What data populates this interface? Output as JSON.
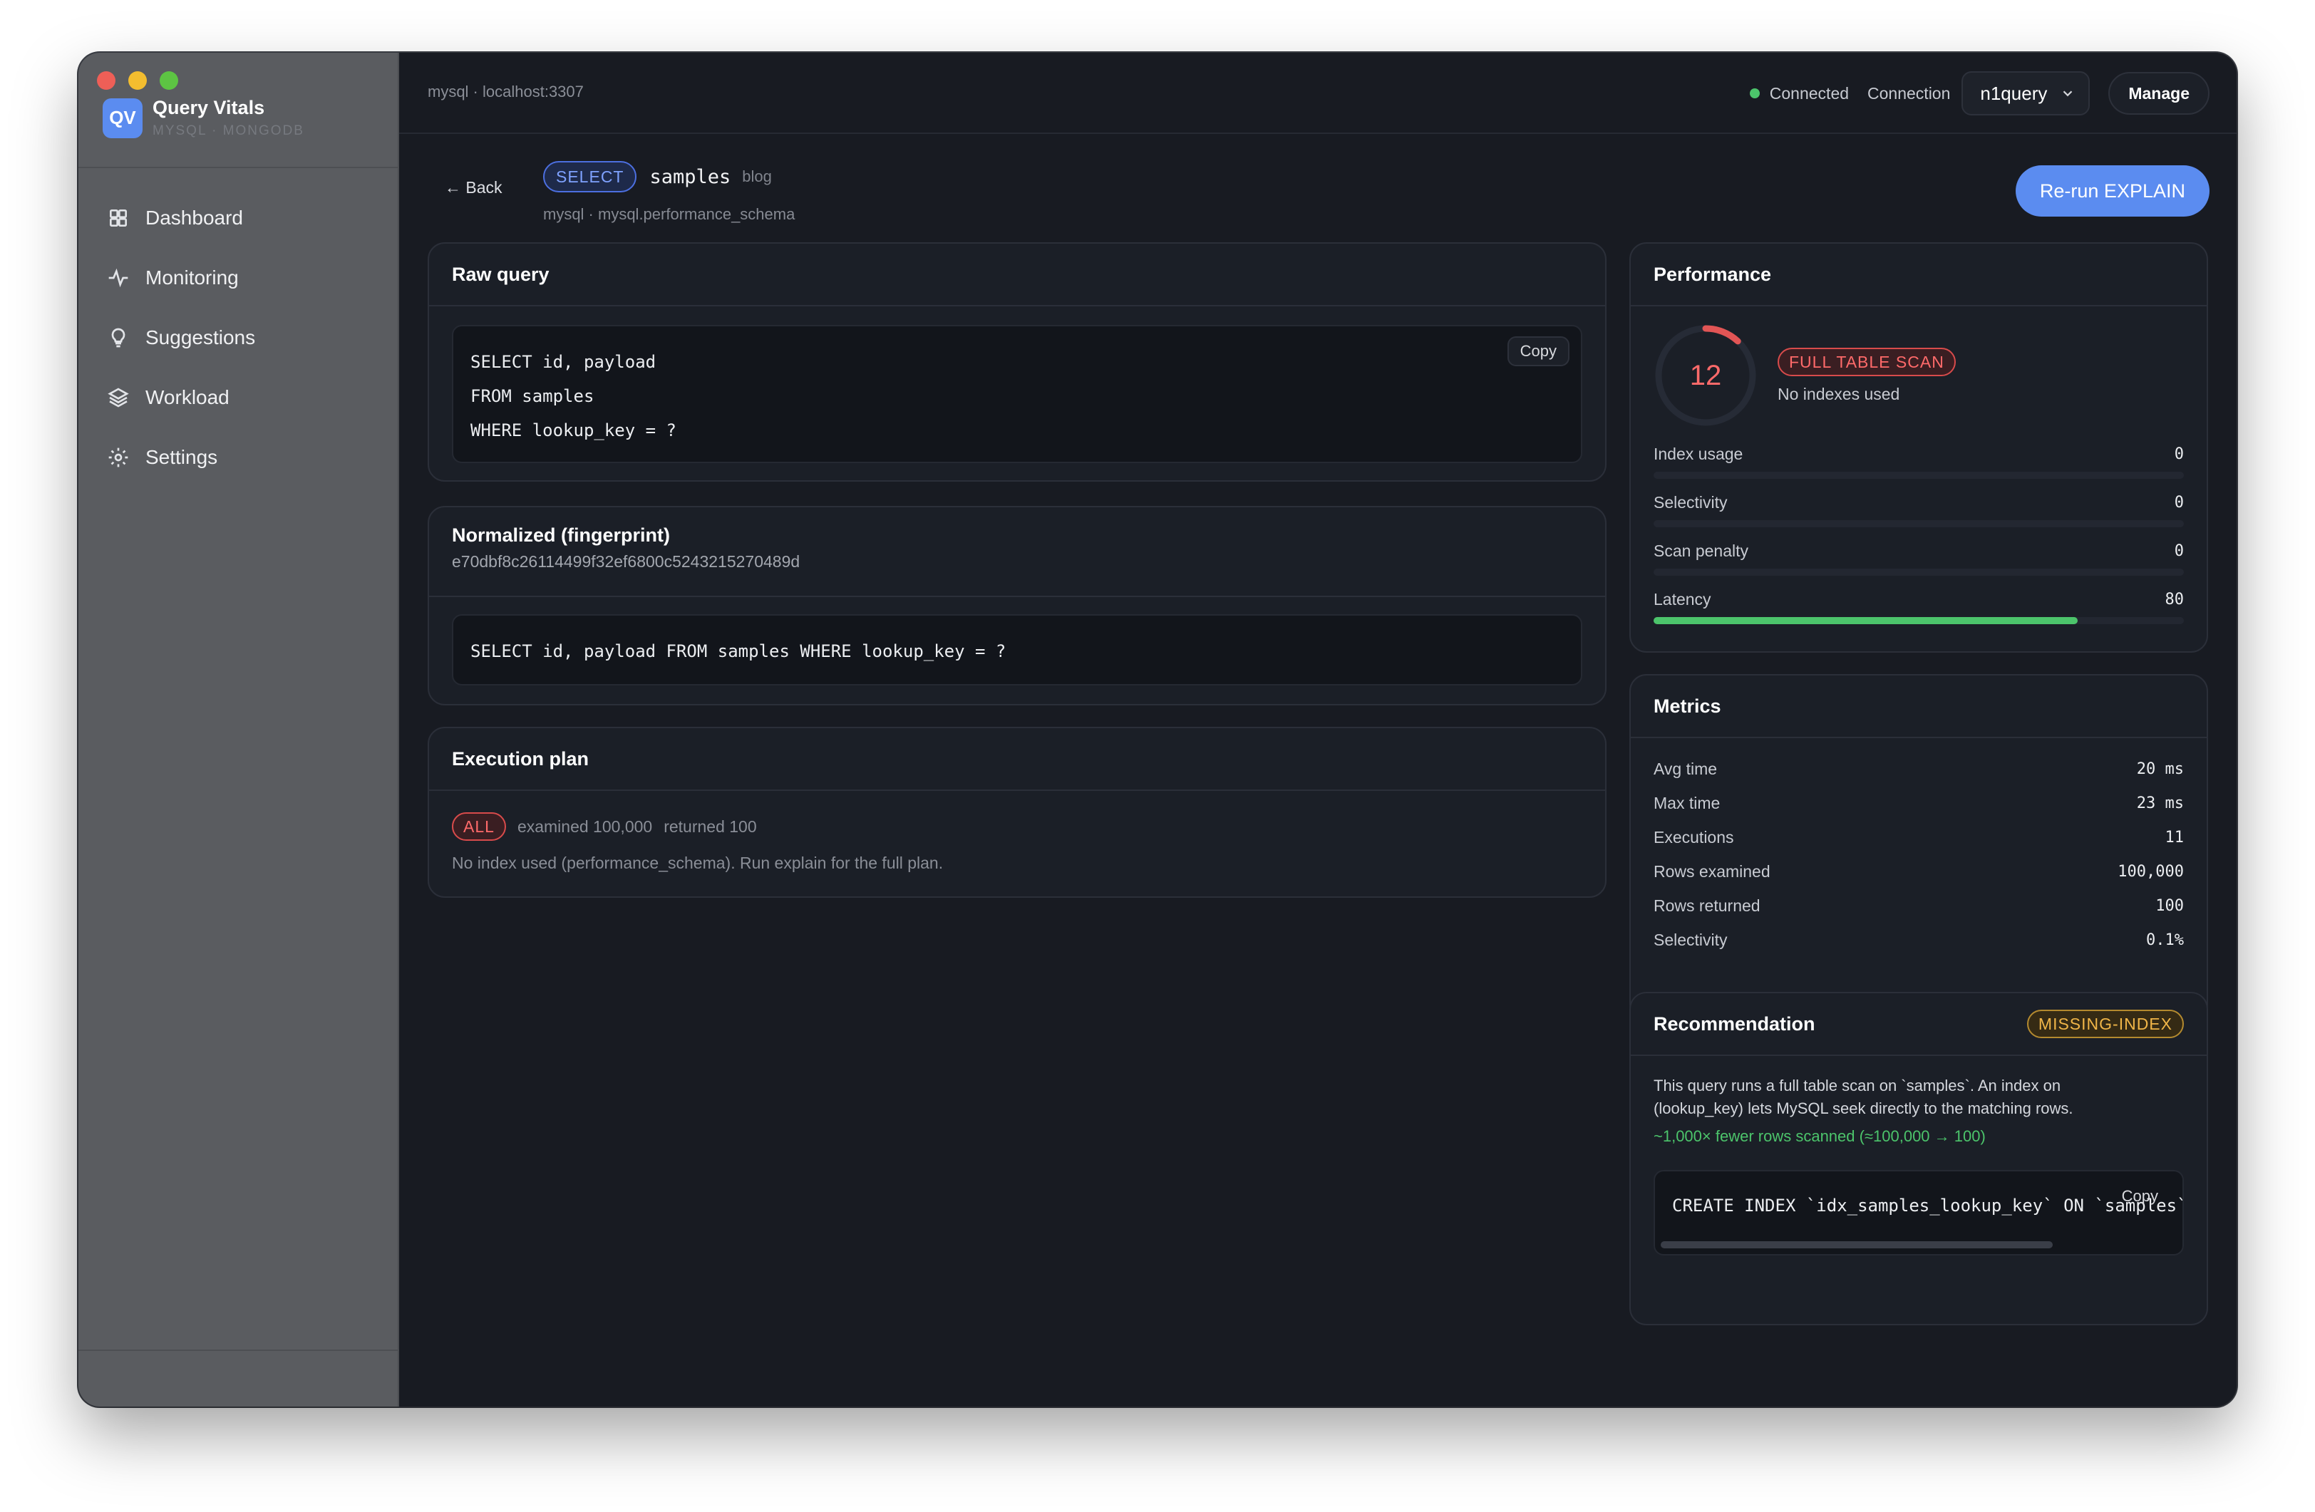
{
  "app": {
    "logo": "QV",
    "name": "Query Vitals",
    "subtitle": "MYSQL · MONGODB"
  },
  "sidebar": {
    "items": [
      {
        "label": "Dashboard",
        "icon": "grid-icon"
      },
      {
        "label": "Monitoring",
        "icon": "pulse-icon"
      },
      {
        "label": "Suggestions",
        "icon": "lightbulb-icon"
      },
      {
        "label": "Workload",
        "icon": "layers-icon"
      },
      {
        "label": "Settings",
        "icon": "gear-icon"
      }
    ]
  },
  "topbar": {
    "host": "mysql · localhost:3307",
    "status": "Connected",
    "connection_label": "Connection",
    "connection_value": "n1query",
    "manage_label": "Manage"
  },
  "header": {
    "back_label": "← Back",
    "query_type": "SELECT",
    "table": "samples",
    "database": "blog",
    "subtitle": "mysql · mysql.performance_schema",
    "rerun_label": "Re-run EXPLAIN"
  },
  "raw_query": {
    "title": "Raw query",
    "copy_label": "Copy",
    "lines": [
      "SELECT id, payload",
      "FROM samples",
      "WHERE lookup_key = ?"
    ]
  },
  "normalized": {
    "title": "Normalized (fingerprint)",
    "hash": "e70dbf8c26114499f32ef6800c5243215270489d",
    "query": "SELECT id, payload FROM samples WHERE lookup_key = ?"
  },
  "execution_plan": {
    "title": "Execution plan",
    "access_type": "ALL",
    "examined": "examined 100,000",
    "returned": "returned 100",
    "note": "No index used (performance_schema). Run explain for the full plan."
  },
  "performance": {
    "title": "Performance",
    "score": "12",
    "score_value": 12,
    "badge": "FULL TABLE SCAN",
    "badge_sub": "No indexes used",
    "bars": [
      {
        "label": "Index usage",
        "value": "0",
        "fraction": 0
      },
      {
        "label": "Selectivity",
        "value": "0",
        "fraction": 0
      },
      {
        "label": "Scan penalty",
        "value": "0",
        "fraction": 0
      },
      {
        "label": "Latency",
        "value": "80",
        "fraction": 0.8
      }
    ]
  },
  "metrics": {
    "title": "Metrics",
    "rows": [
      {
        "label": "Avg time",
        "value": "20 ms"
      },
      {
        "label": "Max time",
        "value": "23 ms"
      },
      {
        "label": "Executions",
        "value": "11"
      },
      {
        "label": "Rows examined",
        "value": "100,000"
      },
      {
        "label": "Rows returned",
        "value": "100"
      },
      {
        "label": "Selectivity",
        "value": "0.1%"
      }
    ]
  },
  "recommendation": {
    "title": "Recommendation",
    "badge": "MISSING-INDEX",
    "text_line1": "This query runs a full table scan on `samples`. An index on",
    "text_line2": "(lookup_key) lets MySQL seek directly to the matching rows.",
    "impact": "~1,000× fewer rows scanned (≈100,000 → 100)",
    "sql": "CREATE INDEX `idx_samples_lookup_key` ON `samples`",
    "copy_label": "Copy"
  },
  "colors": {
    "accent": "#5b8cf0",
    "success": "#4cc46b",
    "danger": "#ff6a6a",
    "warning": "#f0b548"
  }
}
